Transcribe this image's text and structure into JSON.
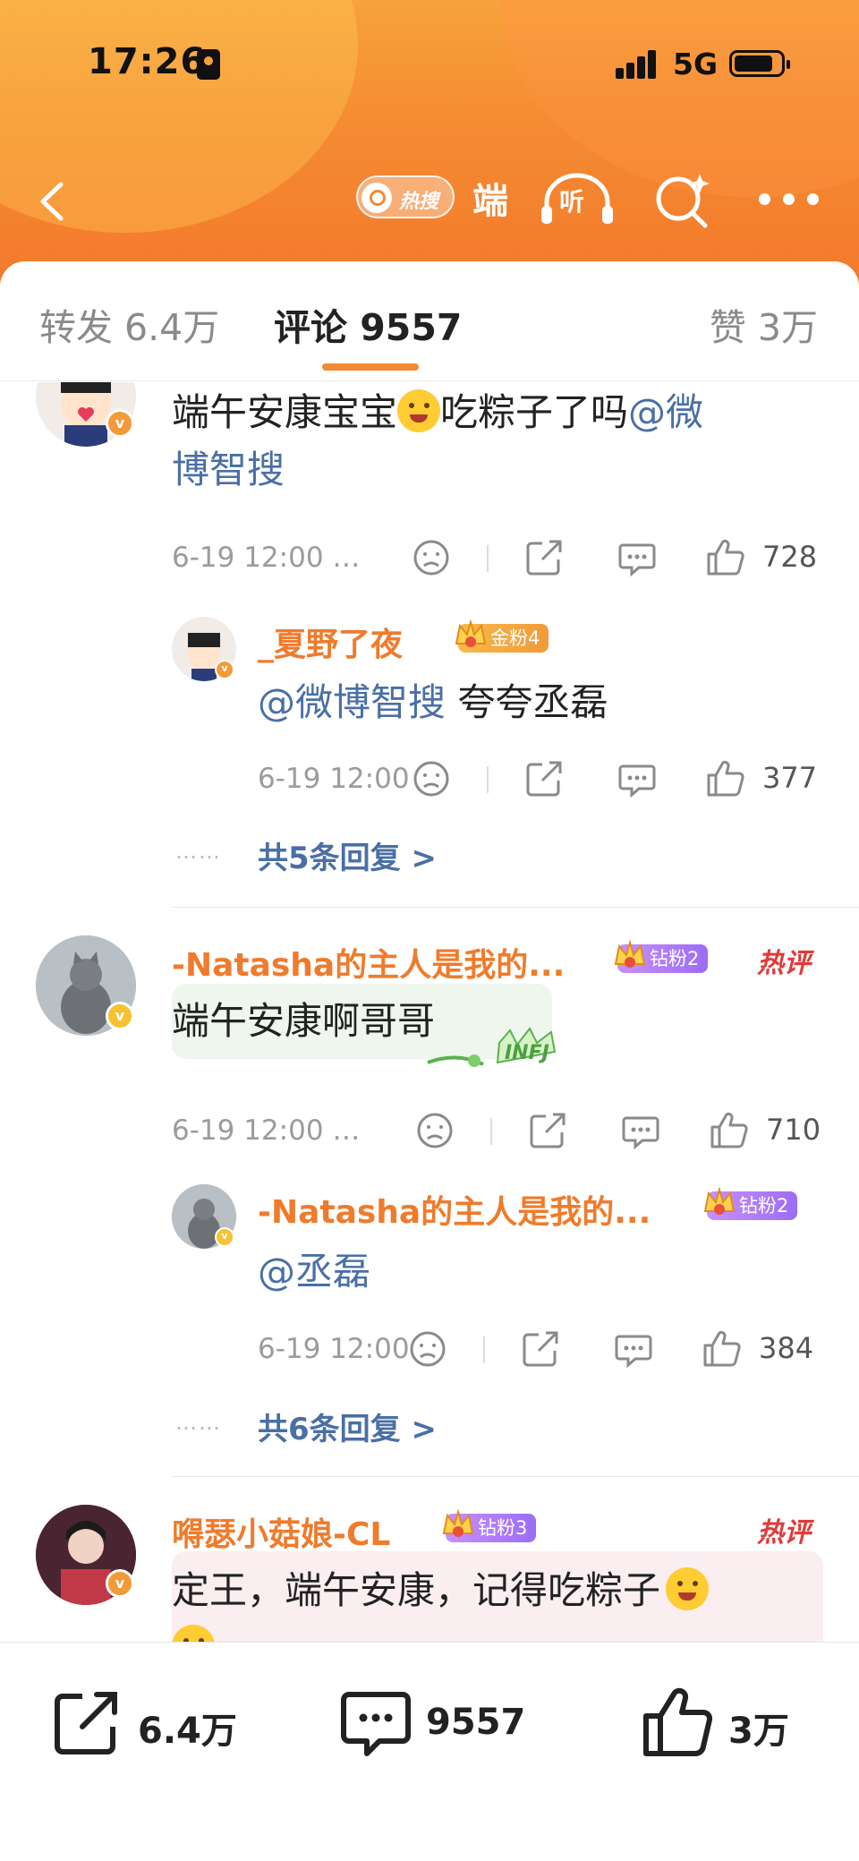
{
  "status_bar": {
    "time": "17:26",
    "network": "5G"
  },
  "nav": {
    "hot_label": "热搜",
    "search_word": "端",
    "listen_label": "听"
  },
  "tabs": [
    {
      "label": "转发 6.4万"
    },
    {
      "label": "评论 9557"
    },
    {
      "label": "赞 3万"
    }
  ],
  "comments": [
    {
      "text_prefix": "端午安康宝宝",
      "text_middle": "吃粽子了吗",
      "mention": "@微",
      "mention_cont": "博智搜",
      "date": "6-19 12:00 …",
      "likes": "728",
      "reply": {
        "username": "_夏野了夜",
        "badge": "金粉4",
        "mention": "@微博智搜",
        "text": " 夸夸丞磊",
        "date": "6-19 12:00",
        "likes": "377"
      },
      "more_replies": "共5条回复 >"
    },
    {
      "username": "-Natasha的主人是我的...",
      "badge": "钻粉2",
      "hot_tag": "热评",
      "text": "端午安康啊哥哥",
      "sticker_text": "INFJ",
      "date": "6-19 12:00 …",
      "likes": "710",
      "reply": {
        "username": "-Natasha的主人是我的...",
        "badge": "钻粉2",
        "mention": "@丞磊",
        "text": "",
        "date": "6-19 12:00",
        "likes": "384"
      },
      "more_replies": "共6条回复 >"
    },
    {
      "username": "嘚瑟小菇娘-CL",
      "badge": "钻粉3",
      "hot_tag": "热评",
      "text": "定王，端午安康，记得吃粽子"
    }
  ],
  "dots": "……",
  "bottom_bar": {
    "reposts": "6.4万",
    "comments": "9557",
    "likes": "3万"
  },
  "colors": {
    "accent": "#f5892f",
    "username": "#ef7b2c",
    "mention": "#4a6fa6",
    "hot_tag": "#e23a3a"
  }
}
